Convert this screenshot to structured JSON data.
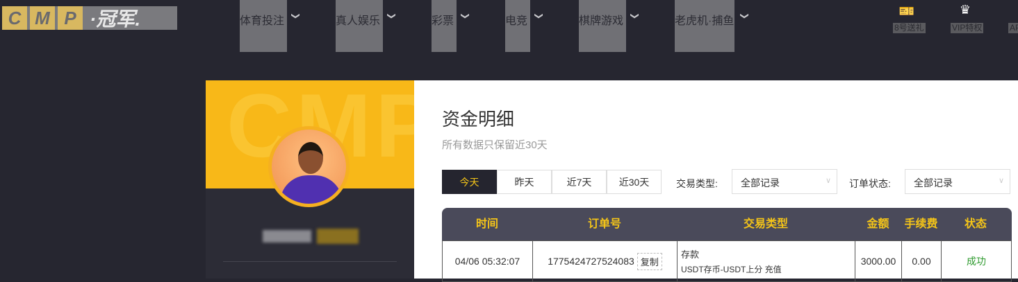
{
  "header": {
    "logo": {
      "letters": [
        "C",
        "M",
        "P"
      ],
      "text": "·冠军."
    },
    "nav": [
      {
        "label": "体育投注"
      },
      {
        "label": "真人娱乐"
      },
      {
        "label": "彩票"
      },
      {
        "label": "电竞"
      },
      {
        "label": "棋牌游戏"
      },
      {
        "label": "老虎机·捕鱼"
      }
    ],
    "tools": [
      {
        "label": "8号送礼",
        "icon": "ticket-yen-icon"
      },
      {
        "label": "VIP特权",
        "icon": "crown-icon"
      },
      {
        "label": "AP"
      }
    ]
  },
  "profile": {
    "banner_text": "CMP"
  },
  "main": {
    "title": "资金明细",
    "subtitle": "所有数据只保留近30天",
    "date_filters": [
      {
        "label": "今天",
        "active": true
      },
      {
        "label": "昨天"
      },
      {
        "label": "近7天"
      },
      {
        "label": "近30天"
      }
    ],
    "type_label": "交易类型:",
    "type_value": "全部记录",
    "status_label": "订单状态:",
    "status_value": "全部记录",
    "table": {
      "headers": [
        "时间",
        "订单号",
        "交易类型",
        "金额",
        "手续费",
        "状态"
      ],
      "rows": [
        {
          "time": "04/06 05:32:07",
          "order": "1775424727524083",
          "copy": "复制",
          "type": "存款",
          "type_detail": "USDT存币-USDT上分 充值",
          "amount": "3000.00",
          "fee": "0.00",
          "status": "成功"
        }
      ]
    },
    "colors": {
      "accent": "#f5c518",
      "success": "#2e9a2e",
      "header_bg": "#4a4a5a"
    }
  }
}
